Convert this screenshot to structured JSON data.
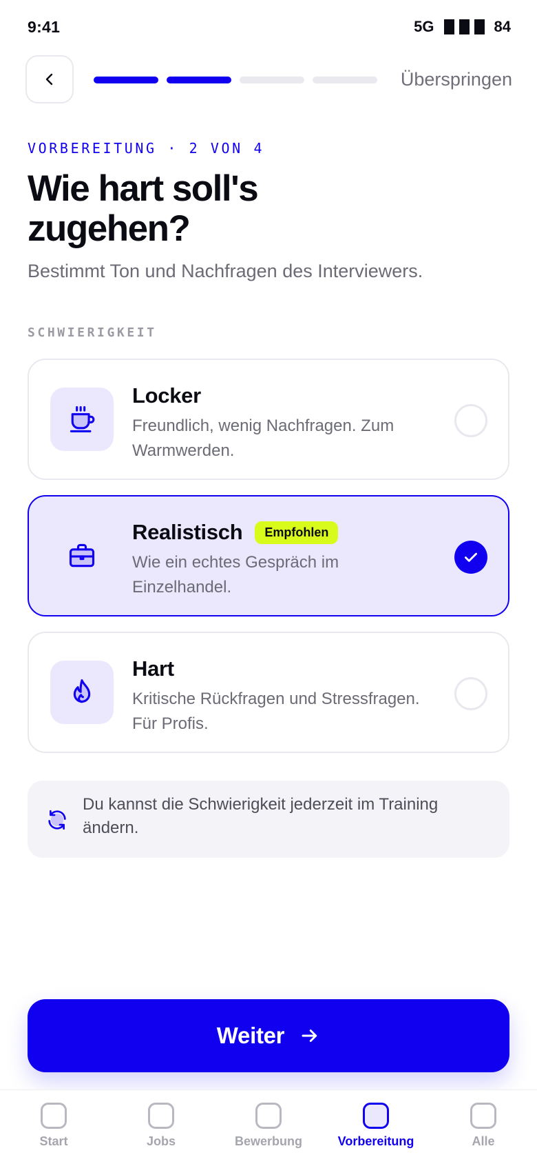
{
  "status": {
    "time": "9:41",
    "network": "5G",
    "battery": "84"
  },
  "header": {
    "back_icon": "chevron-left-icon",
    "progress_steps": 4,
    "progress_current": 2,
    "skip_label": "Überspringen"
  },
  "content": {
    "eyebrow": "VORBEREITUNG · 2 VON 4",
    "title": "Wie hart soll's zugehen?",
    "subtitle": "Bestimmt Ton und Nachfragen des Interviewers.",
    "section_label": "SCHWIERIGKEIT"
  },
  "options": [
    {
      "title": "Locker",
      "description": "Freundlich, wenig Nachfragen. Zum Warmwerden.",
      "icon": "coffee-cup-icon",
      "selected": false
    },
    {
      "title": "Realistisch",
      "badge": "Empfohlen",
      "description": "Wie ein echtes Gespräch im Einzelhandel.",
      "icon": "briefcase-icon",
      "selected": true
    },
    {
      "title": "Hart",
      "description": "Kritische Rückfragen und Stressfragen. Für Profis.",
      "icon": "flame-icon",
      "selected": false
    }
  ],
  "info": {
    "icon": "refresh-icon",
    "text": "Du kannst die Schwierigkeit jederzeit im Training ändern."
  },
  "cta": {
    "label": "Weiter",
    "icon": "arrow-right-icon"
  },
  "tabbar": {
    "items": [
      {
        "label": "Start",
        "active": false
      },
      {
        "label": "Jobs",
        "active": false
      },
      {
        "label": "Bewerbung",
        "active": false
      },
      {
        "label": "Vorbereitung",
        "active": true
      },
      {
        "label": "Alle",
        "active": false
      }
    ]
  },
  "colors": {
    "accent": "#1100f0",
    "accent_soft": "#ebe8fd",
    "badge": "#d8fb1b",
    "muted": "#6b6b76"
  }
}
